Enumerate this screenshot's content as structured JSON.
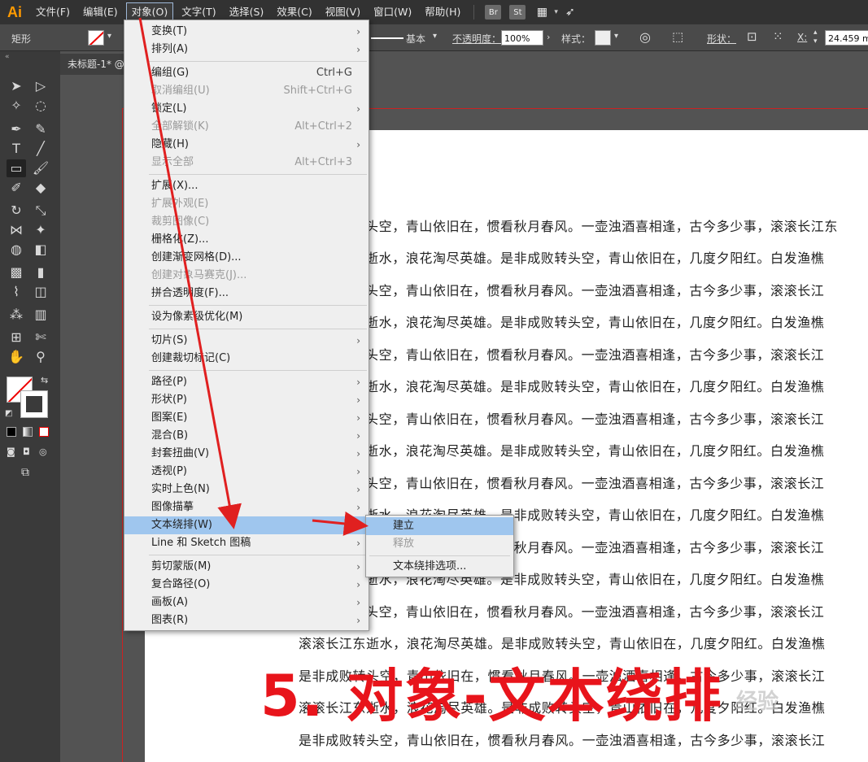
{
  "app": {
    "logo": "Ai"
  },
  "menubar": {
    "items": [
      "文件(F)",
      "编辑(E)",
      "对象(O)",
      "文字(T)",
      "选择(S)",
      "效果(C)",
      "视图(V)",
      "窗口(W)",
      "帮助(H)"
    ],
    "icons": {
      "br": "Br",
      "st": "St"
    }
  },
  "control_bar": {
    "shape_label": "矩形",
    "stroke_style": "基本",
    "opacity_label": "不透明度：",
    "opacity_value": "100%",
    "style_label": "样式：",
    "shape_props_label": "形状：",
    "x_label": "X:",
    "x_value": "24.459 m"
  },
  "document": {
    "tab_title": "未标题-1* @"
  },
  "text_lines": [
    "头空，青山依旧在，惯看秋月春风。一壶浊酒喜相逢，古今多少事，滚滚长江东",
    "逝水，浪花淘尽英雄。是非成败转头空，青山依旧在，几度夕阳红。白发渔樵",
    "头空，青山依旧在，惯看秋月春风。一壶浊酒喜相逢，古今多少事，滚滚长江",
    "逝水，浪花淘尽英雄。是非成败转头空，青山依旧在，几度夕阳红。白发渔樵",
    "头空，青山依旧在，惯看秋月春风。一壶浊酒喜相逢，古今多少事，滚滚长江",
    "逝水，浪花淘尽英雄。是非成败转头空，青山依旧在，几度夕阳红。白发渔樵",
    "头空，青山依旧在，惯看秋月春风。一壶浊酒喜相逢，古今多少事，滚滚长江",
    "逝水，浪花淘尽英雄。是非成败转头空，青山依旧在，几度夕阳红。白发渔樵",
    "头空，青山依旧在，惯看秋月春风。一壶浊酒喜相逢，古今多少事，滚滚长江",
    "逝水，浪花淘尽英雄。是非成败转头空，青山依旧在，几度夕阳红。白发渔樵",
    "头空，青山依旧在，惯看秋月春风。一壶浊酒喜相逢，古今多少事，滚滚长江",
    "逝水，浪花淘尽英雄。是非成败转头空，青山依旧在，几度夕阳红。白发渔樵",
    "头空，青山依旧在，惯看秋月春风。一壶浊酒喜相逢，古今多少事，滚滚长江",
    "滚滚长江东逝水，浪花淘尽英雄。是非成败转头空，青山依旧在，几度夕阳红。白发渔樵",
    "是非成败转头空，青山依旧在，惯看秋月春风。一壶浊酒喜相逢，古今多少事，滚滚长江",
    "滚滚长江东逝水，浪花淘尽英雄。是非成败转头空，青山依旧在，几度夕阳红。白发渔樵",
    "是非成败转头空，青山依旧在，惯看秋月春风。一壶浊酒喜相逢，古今多少事，滚滚长江"
  ],
  "object_menu": {
    "items": [
      {
        "label": "变换(T)",
        "sub": true
      },
      {
        "label": "排列(A)",
        "sub": true
      },
      {
        "label": "编组(G)",
        "shortcut": "Ctrl+G"
      },
      {
        "label": "取消编组(U)",
        "shortcut": "Shift+Ctrl+G",
        "disabled": true
      },
      {
        "label": "锁定(L)",
        "sub": true
      },
      {
        "label": "全部解锁(K)",
        "shortcut": "Alt+Ctrl+2",
        "disabled": true
      },
      {
        "label": "隐藏(H)",
        "sub": true
      },
      {
        "label": "显示全部",
        "shortcut": "Alt+Ctrl+3",
        "disabled": true
      },
      {
        "label": "扩展(X)..."
      },
      {
        "label": "扩展外观(E)",
        "disabled": true
      },
      {
        "label": "裁剪图像(C)",
        "disabled": true
      },
      {
        "label": "栅格化(Z)..."
      },
      {
        "label": "创建渐变网格(D)..."
      },
      {
        "label": "创建对象马赛克(J)...",
        "disabled": true
      },
      {
        "label": "拼合透明度(F)..."
      },
      {
        "label": "设为像素级优化(M)"
      },
      {
        "label": "切片(S)",
        "sub": true
      },
      {
        "label": "创建裁切标记(C)"
      },
      {
        "label": "路径(P)",
        "sub": true
      },
      {
        "label": "形状(P)",
        "sub": true
      },
      {
        "label": "图案(E)",
        "sub": true
      },
      {
        "label": "混合(B)",
        "sub": true
      },
      {
        "label": "封套扭曲(V)",
        "sub": true
      },
      {
        "label": "透视(P)",
        "sub": true
      },
      {
        "label": "实时上色(N)",
        "sub": true
      },
      {
        "label": "图像描摹",
        "sub": true
      },
      {
        "label": "文本绕排(W)",
        "sub": true,
        "highlighted": true
      },
      {
        "label": "Line 和 Sketch 图稿",
        "sub": true
      },
      {
        "label": "剪切蒙版(M)",
        "sub": true
      },
      {
        "label": "复合路径(O)",
        "sub": true
      },
      {
        "label": "画板(A)",
        "sub": true
      },
      {
        "label": "图表(R)",
        "sub": true
      }
    ]
  },
  "submenu": {
    "items": [
      {
        "label": "建立",
        "highlighted": true
      },
      {
        "label": "释放",
        "disabled": true
      },
      {
        "label": "文本绕排选项..."
      }
    ]
  },
  "caption": "5. 对象-文本绕排",
  "watermark": "经验",
  "colors": {
    "accent_red": "#e8141b",
    "menu_highlight": "#9fc6ee"
  }
}
